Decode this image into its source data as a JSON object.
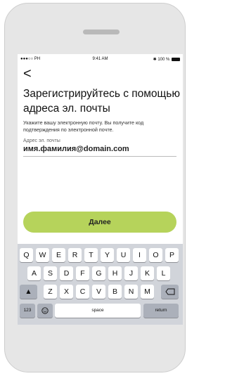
{
  "statusbar": {
    "carrier": "●●●○○ PH",
    "time": "9:41 AM",
    "battery": "100 %"
  },
  "nav": {
    "back_label": "<"
  },
  "screen": {
    "title": "Зарегистрируйтесь с помощью адреса эл. почты",
    "subtitle": "Укажите вашу электронную почту. Вы получите код подтверждения по электронной почте.",
    "email_label": "Адрес эл. почты",
    "email_value": "имя.фамилия@domain.com",
    "next_button": "Далее"
  },
  "keyboard": {
    "row1": [
      "Q",
      "W",
      "E",
      "R",
      "T",
      "Y",
      "U",
      "I",
      "O",
      "P"
    ],
    "row2": [
      "A",
      "S",
      "D",
      "F",
      "G",
      "H",
      "J",
      "K",
      "L"
    ],
    "row3": [
      "Z",
      "X",
      "C",
      "V",
      "B",
      "N",
      "M"
    ],
    "shift_icon": "shift-arrow",
    "backspace_icon": "backspace",
    "numbers_key": "123",
    "emoji_icon": "emoji",
    "space_key": "space",
    "return_key": "return"
  }
}
